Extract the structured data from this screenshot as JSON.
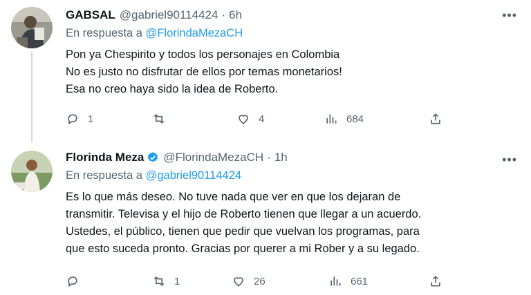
{
  "tweets": [
    {
      "name": "GABSAL",
      "handle": "@gabriel90114424",
      "dot": "·",
      "time": "6h",
      "verified": false,
      "reply_prefix": "En respuesta a",
      "reply_to": "@FlorindaMezaCH",
      "lines": [
        "Pon ya Chespirito y todos los personajes en Colombia",
        "No es justo no disfrutar de ellos por temas monetarios!",
        "Esa no creo haya sido la idea de Roberto."
      ],
      "replies": "1",
      "retweets": "",
      "likes": "4",
      "views": "684"
    },
    {
      "name": "Florinda Meza",
      "handle": "@FlorindaMezaCH",
      "dot": "·",
      "time": "1h",
      "verified": true,
      "reply_prefix": "En respuesta a",
      "reply_to": "@gabriel90114424",
      "lines": [
        "Es lo que más deseo. No tuve nada que ver en que los dejaran de",
        "transmitir. Televisa y el hijo de Roberto tienen que llegar a un acuerdo.",
        "Ustedes, el público, tienen que pedir que vuelvan los programas, para",
        "que esto suceda pronto. Gracias por querer a mi Rober y a su legado."
      ],
      "replies": "",
      "retweets": "1",
      "likes": "26",
      "views": "661"
    }
  ],
  "icons": {
    "more": "more-icon",
    "reply": "reply-icon",
    "retweet": "retweet-icon",
    "like": "heart-icon",
    "views": "views-icon",
    "share": "share-icon"
  },
  "colors": {
    "text": "#0f1419",
    "muted": "#536471",
    "link": "#1d9bf0",
    "verified": "#1d9bf0",
    "thread_line": "#cfd9de"
  }
}
